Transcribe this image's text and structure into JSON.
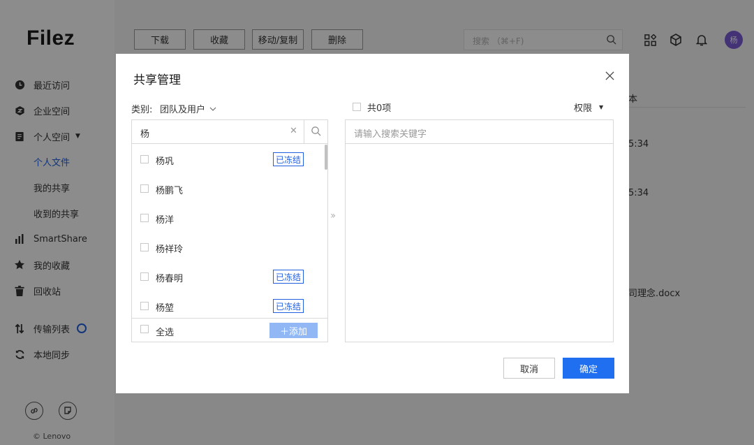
{
  "app": {
    "logo": "Filez",
    "copyright": "© Lenovo"
  },
  "sidebar": {
    "items": [
      {
        "label": "最近访问",
        "icon": "clock-icon"
      },
      {
        "label": "企业空间",
        "icon": "enterprise-icon"
      },
      {
        "label": "个人空间",
        "icon": "document-icon"
      },
      {
        "label": "SmartShare",
        "icon": "bar-chart-icon"
      },
      {
        "label": "我的收藏",
        "icon": "star-icon"
      },
      {
        "label": "回收站",
        "icon": "trash-icon"
      },
      {
        "label": "传输列表",
        "icon": "transfer-icon"
      },
      {
        "label": "本地同步",
        "icon": "sync-icon"
      }
    ],
    "sub_items": [
      {
        "label": "个人文件",
        "active": true
      },
      {
        "label": "我的共享",
        "active": false
      },
      {
        "label": "收到的共享",
        "active": false
      }
    ]
  },
  "toolbar": {
    "download": "下载",
    "favorite": "收藏",
    "move_copy": "移动/复制",
    "delete": "删除"
  },
  "search": {
    "placeholder": "搜索 （⌘+F)"
  },
  "user": {
    "avatar_text": "杨",
    "avatar_color": "#7b5bd6"
  },
  "background": {
    "header_fragment": "本",
    "time_1": "5:34",
    "time_2": "5:34",
    "file_fragment": "司理念.docx"
  },
  "dialog": {
    "title": "共享管理",
    "category_label": "类别:",
    "category_value": "团队及用户",
    "search_value": "杨",
    "users": [
      {
        "name": "杨巩",
        "frozen": true
      },
      {
        "name": "杨鹏飞",
        "frozen": false
      },
      {
        "name": "杨洋",
        "frozen": false
      },
      {
        "name": "杨祥玲",
        "frozen": false
      },
      {
        "name": "杨春明",
        "frozen": true
      },
      {
        "name": "杨堃",
        "frozen": true
      }
    ],
    "frozen_tag": "已冻结",
    "select_all": "全选",
    "add_button": "＋添加",
    "total_label": "共0项",
    "permission_label": "权限",
    "right_search_placeholder": "请输入搜索关键字",
    "cancel": "取消",
    "confirm": "确定",
    "accent_color": "#1f6ff0"
  }
}
